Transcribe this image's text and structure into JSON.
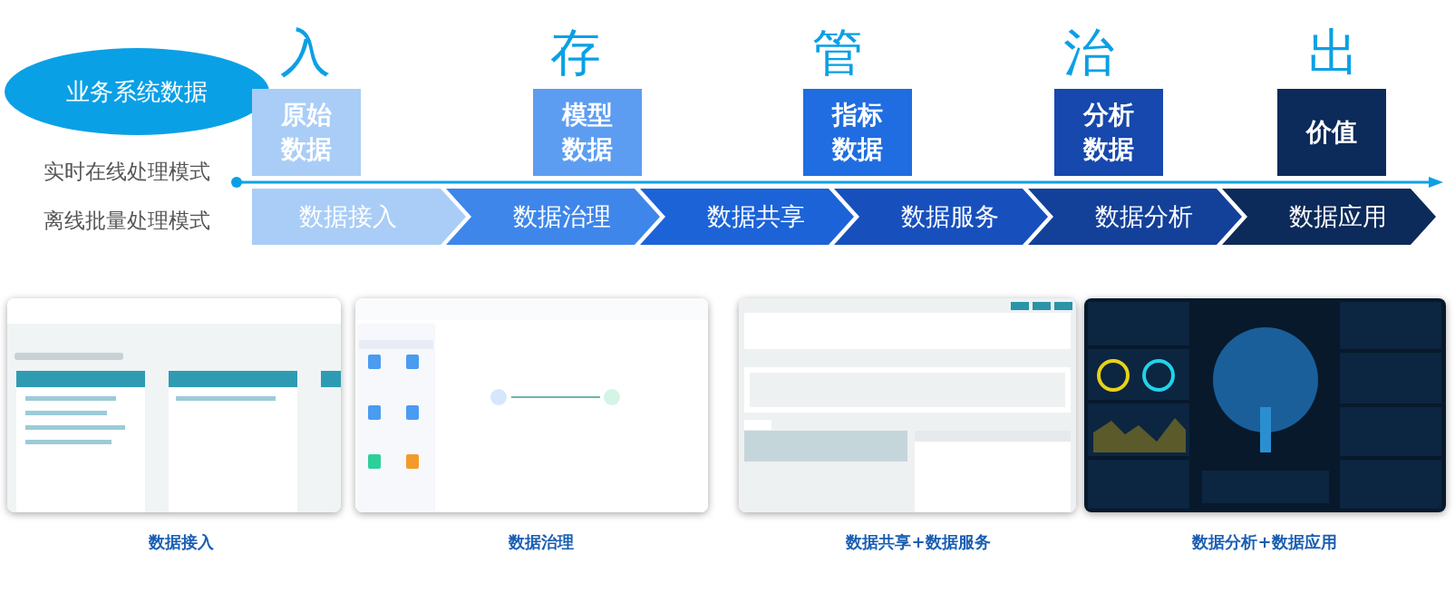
{
  "source": {
    "label": "业务系统数据"
  },
  "stages": [
    {
      "char": "入",
      "lines": [
        "原始",
        "数据"
      ],
      "color": "#a9cdf6"
    },
    {
      "char": "存",
      "lines": [
        "模型",
        "数据"
      ],
      "color": "#5d9df1"
    },
    {
      "char": "管",
      "lines": [
        "指标",
        "数据"
      ],
      "color": "#1f6de0"
    },
    {
      "char": "治",
      "lines": [
        "分析",
        "数据"
      ],
      "color": "#1648ad"
    },
    {
      "char": "出",
      "lines": [
        "价值"
      ],
      "color": "#0c2a5a"
    }
  ],
  "modes": [
    "实时在线处理模式",
    "离线批量处理模式"
  ],
  "steps": [
    {
      "label": "数据接入",
      "color": "#a9cdf6"
    },
    {
      "label": "数据治理",
      "color": "#3f86ea"
    },
    {
      "label": "数据共享",
      "color": "#1c63d8"
    },
    {
      "label": "数据服务",
      "color": "#1750bd"
    },
    {
      "label": "数据分析",
      "color": "#13419a"
    },
    {
      "label": "数据应用",
      "color": "#0c2a5a"
    }
  ],
  "screenshots": [
    {
      "kind": "picture",
      "caption": "数据接入"
    },
    {
      "kind": "picture",
      "caption": "数据治理"
    },
    {
      "kind": "picture",
      "caption": "数据共享+数据服务"
    },
    {
      "kind": "picture",
      "caption": "数据分析+数据应用"
    }
  ]
}
